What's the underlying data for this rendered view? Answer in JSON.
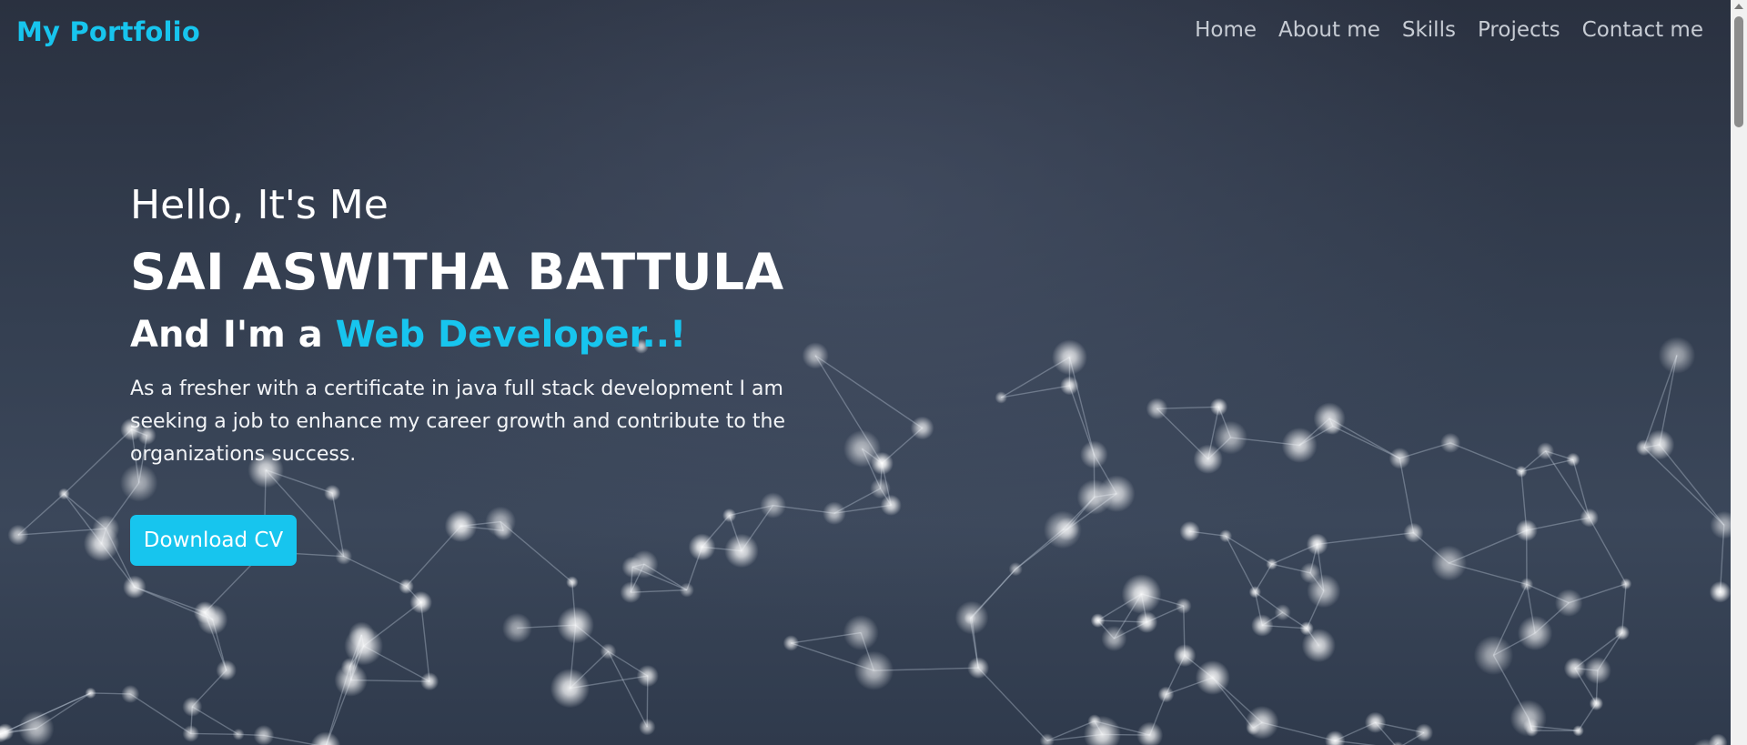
{
  "navbar": {
    "brand": "My Portfolio",
    "links": [
      "Home",
      "About me",
      "Skills",
      "Projects",
      "Contact me"
    ]
  },
  "hero": {
    "greeting": "Hello, It's Me",
    "name": "SAI ASWITHA BATTULA",
    "role_prefix": "And I'm a ",
    "role_highlight": "Web Developer..!",
    "bio": "As a fresher with a certificate in java full stack development I am seeking a job to enhance my career growth and contribute to the organizations success.",
    "button_label": "Download CV"
  },
  "colors": {
    "accent": "#17c5ee",
    "background": "#354052",
    "text": "#ffffff",
    "nav_text": "#c7ccd4"
  },
  "icons": [
    "scroll-up-arrow-icon"
  ]
}
